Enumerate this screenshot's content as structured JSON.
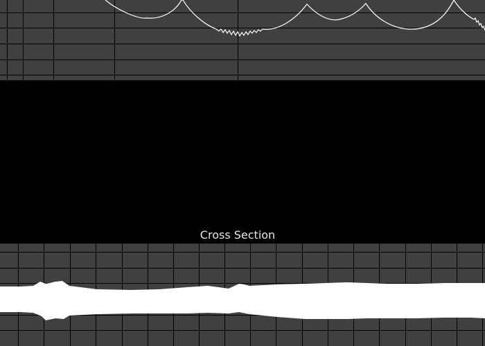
{
  "colors": {
    "panel_background": "#404040",
    "grid_line": "#000000",
    "profile_curve": "#ffffff",
    "cross_section_fill": "#ffffff",
    "label_text": "#e6e6e6",
    "window_background": "#000000"
  },
  "cross_section": {
    "label": "Cross Section"
  }
}
